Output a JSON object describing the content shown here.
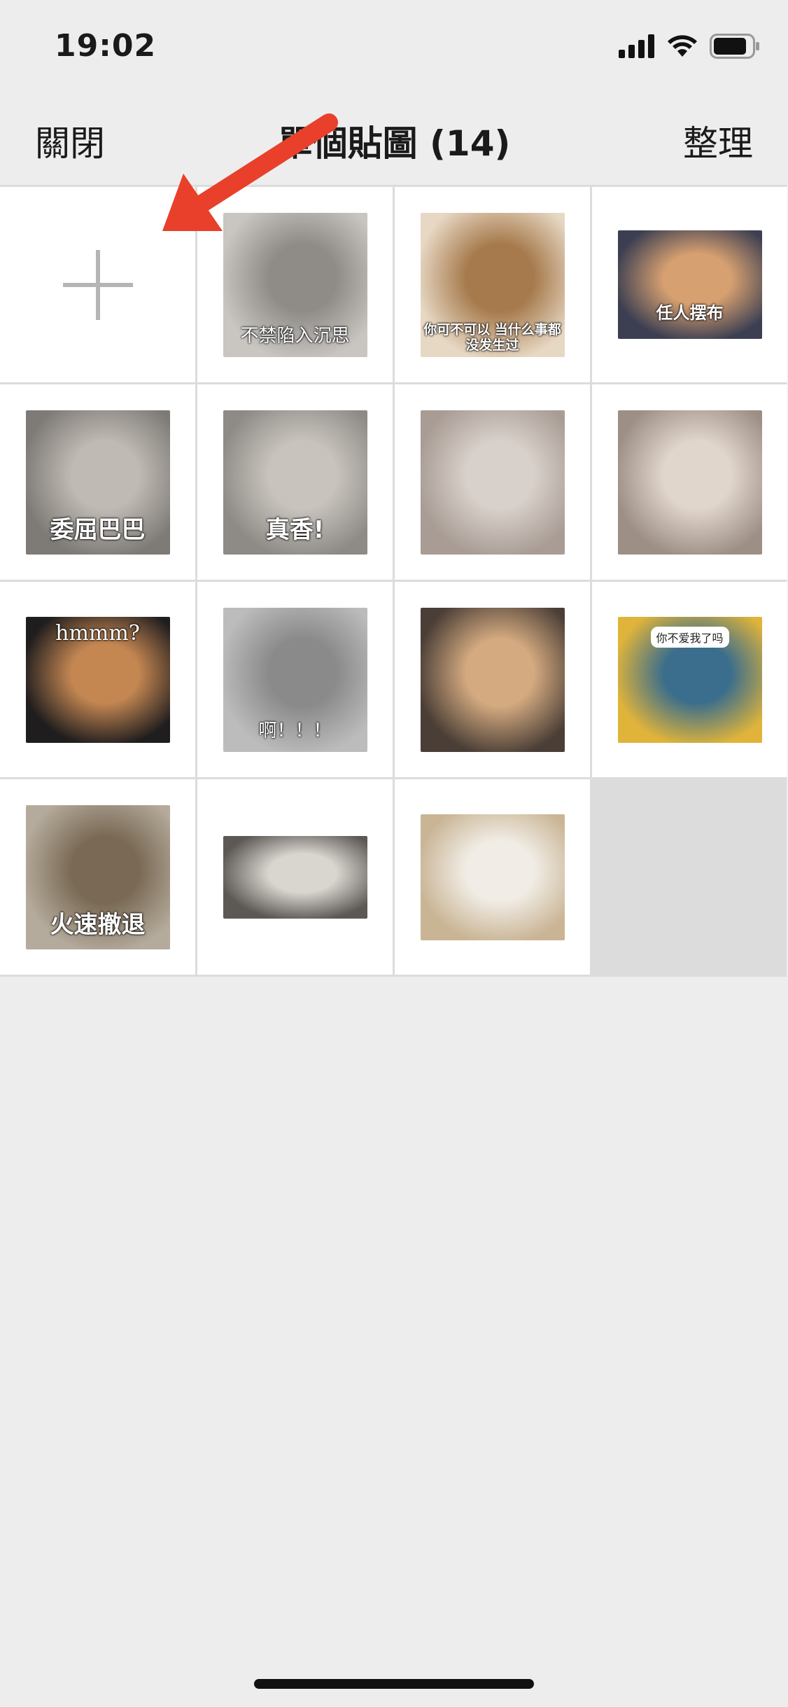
{
  "status_bar": {
    "time": "19:02",
    "icons": [
      "cellular-signal-icon",
      "wifi-icon",
      "battery-icon"
    ]
  },
  "nav": {
    "close_label": "關閉",
    "title": "單個貼圖 (14)",
    "organize_label": "整理"
  },
  "add_cell": {
    "icon": "plus-icon"
  },
  "annotation": {
    "icon": "red-arrow-icon",
    "color": "#e8402a"
  },
  "stickers": [
    {
      "caption": "不禁陷入沉思",
      "colors": [
        "#c9c6c2",
        "#8f8c88"
      ]
    },
    {
      "caption": "你可不可以 当什么事都没发生过",
      "colors": [
        "#e7d8c4",
        "#a67a4c"
      ]
    },
    {
      "caption": "任人摆布",
      "colors": [
        "#3c3f52",
        "#d7a070"
      ]
    },
    {
      "caption": "委屈巴巴",
      "colors": [
        "#7e7a76",
        "#bfbab3"
      ]
    },
    {
      "caption": "真香!",
      "colors": [
        "#8e8b86",
        "#c8c3bd"
      ]
    },
    {
      "caption": "",
      "colors": [
        "#a89c94",
        "#d8d0ca"
      ]
    },
    {
      "caption": "",
      "colors": [
        "#9d8f86",
        "#e1d6cc"
      ]
    },
    {
      "caption": "hmmm?",
      "colors": [
        "#1f1d1e",
        "#c58752"
      ]
    },
    {
      "caption": "啊！！！",
      "colors": [
        "#bcbcbc",
        "#8a8a8a"
      ]
    },
    {
      "caption": "",
      "colors": [
        "#4a3e36",
        "#d4aa80"
      ]
    },
    {
      "caption": "你不爱我了吗",
      "colors": [
        "#e0b43a",
        "#3b6e8c"
      ]
    },
    {
      "caption": "火速撤退",
      "colors": [
        "#b5ab9c",
        "#7a6a55"
      ]
    },
    {
      "caption": "",
      "colors": [
        "#5c5854",
        "#d9d6d0"
      ]
    },
    {
      "caption": "",
      "colors": [
        "#c9b494",
        "#f1ede6"
      ]
    }
  ],
  "colors": {
    "background": "#ededed",
    "cell": "#ffffff",
    "grid_line": "#dcdcdc",
    "plus": "#b5b5b5",
    "arrow": "#e8402a"
  }
}
